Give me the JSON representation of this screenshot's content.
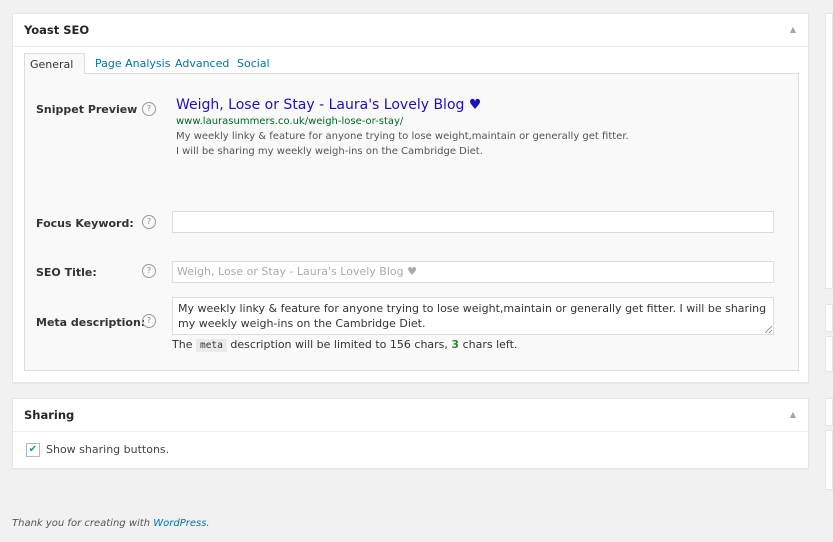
{
  "yoast": {
    "title": "Yoast SEO",
    "toggle_icon": "triangle-up-icon",
    "tabs": [
      {
        "label": "General",
        "active": true
      },
      {
        "label": "Page Analysis",
        "active": false
      },
      {
        "label": "Advanced",
        "active": false
      },
      {
        "label": "Social",
        "active": false
      }
    ],
    "snippet": {
      "label": "Snippet Preview",
      "title": "Weigh, Lose or Stay - Laura's Lovely Blog ♥",
      "url": "www.laurasummers.co.uk/weigh-lose-or-stay/",
      "description_line1": "My weekly linky & feature for anyone trying to lose weight,maintain or generally get fitter.",
      "description_line2": "I will be sharing my weekly weigh-ins on the Cambridge Diet."
    },
    "focus_keyword": {
      "label": "Focus Keyword:",
      "value": ""
    },
    "seo_title": {
      "label": "SEO Title:",
      "placeholder": "Weigh, Lose or Stay  - Laura's Lovely Blog ♥"
    },
    "meta_description": {
      "label": "Meta description:",
      "value": "My weekly linky & feature for anyone trying to lose weight,maintain or generally get fitter. I will be sharing my weekly weigh-ins on the Cambridge Diet.",
      "note_prefix": "The",
      "note_code": "meta",
      "note_middle": "description will be limited to 156 chars,",
      "chars_left": "3",
      "note_suffix": "chars left."
    },
    "help_glyph": "?"
  },
  "sharing": {
    "title": "Sharing",
    "toggle_icon": "triangle-up-icon",
    "checkbox_label": "Show sharing buttons.",
    "checked": true
  },
  "footer": {
    "text": "Thank you for creating with",
    "link": "WordPress",
    "suffix": "."
  },
  "colors": {
    "link": "#0073aa",
    "snippet_title": "#1e0fbe",
    "snippet_url": "#006621",
    "chars_ok": "#2a8a2a"
  }
}
